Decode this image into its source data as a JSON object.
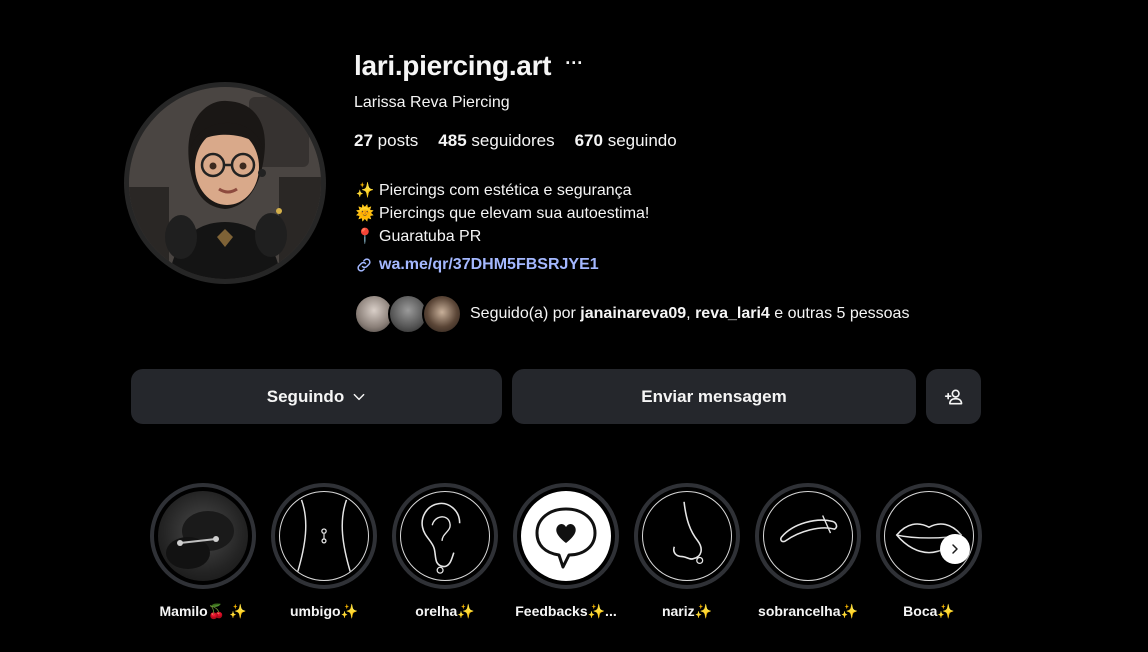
{
  "profile": {
    "username": "lari.piercing.art",
    "more_glyph": "···",
    "full_name": "Larissa Reva Piercing",
    "stats": {
      "posts_count": "27",
      "posts_label": "posts",
      "followers_count": "485",
      "followers_label": "seguidores",
      "following_count": "670",
      "following_label": "seguindo"
    },
    "bio": [
      {
        "emoji": "✨",
        "text": " Piercings com estética e segurança"
      },
      {
        "emoji": "🌞",
        "text": "Piercings que elevam sua autoestima!"
      },
      {
        "emoji": "📍",
        "text": "Guaratuba PR"
      }
    ],
    "link": "wa.me/qr/37DHM5FBSRJYE1",
    "followed_by": {
      "prefix": "Seguido(a) por",
      "user1": "janainareva09",
      "separator": ",",
      "user2": "reva_lari4",
      "suffix": "e outras 5 pessoas"
    }
  },
  "actions": {
    "following_label": "Seguindo",
    "message_label": "Enviar mensagem"
  },
  "highlights": [
    {
      "label": "Mamilo🍒 ✨",
      "icon": "nipple-photo"
    },
    {
      "label": "umbigo✨",
      "icon": "navel-outline-icon"
    },
    {
      "label": "orelha✨",
      "icon": "ear-outline-icon"
    },
    {
      "label": "Feedbacks✨...",
      "icon": "heart-speech-bubble-icon"
    },
    {
      "label": "nariz✨",
      "icon": "nose-outline-icon"
    },
    {
      "label": "sobrancelha✨",
      "icon": "eyebrow-outline-icon"
    },
    {
      "label": "Boca✨",
      "icon": "lips-outline-icon"
    }
  ],
  "colors": {
    "background": "#000000",
    "button_bg": "#25272c",
    "link": "#a4b8ff",
    "text": "#f5f5f5"
  }
}
